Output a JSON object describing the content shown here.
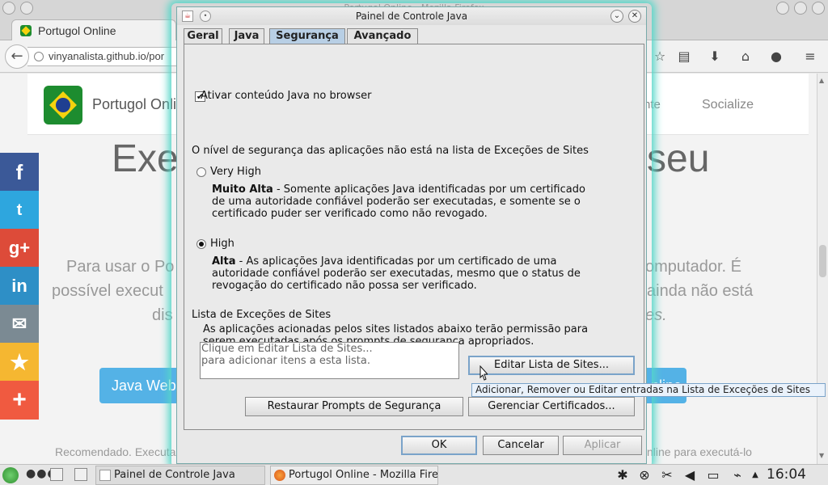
{
  "browser": {
    "window_title": "Portugol Online - Mozilla Firefox",
    "tab_label": "Portugol Online",
    "url": "vinyanalista.github.io/por"
  },
  "page": {
    "site_title": "Portugol Onli",
    "nav_partial": "nte",
    "nav_socialize": "Socialize",
    "hero_left": "Exe",
    "hero_right": "seu",
    "line1_left": "Para usar o Po",
    "line1_right": "omputador. É",
    "line2_left": "possível execut",
    "line2_right": "ainda não está",
    "line3_left": "dis",
    "line3_right": "es.",
    "java_web_button": "Java Web",
    "online_button": "nline",
    "footer_left": "Recomendado. Executa",
    "footer_right": "nline para executá-lo"
  },
  "share": {
    "facebook": "f",
    "twitter": "t",
    "googleplus": "g+",
    "linkedin": "in",
    "email": "✉",
    "favorite": "★",
    "more": "+"
  },
  "dialog": {
    "title": "Painel de Controle Java",
    "tabs": [
      "Geral",
      "Java",
      "Segurança",
      "Avançado"
    ],
    "active_tab": "Segurança",
    "enable_java_label": "Ativar conteúdo Java no browser",
    "enable_java_checked": true,
    "level_notice": "O nível de segurança das aplicações não está na lista de Exceções de Sites",
    "levels": [
      {
        "label": "Very High",
        "selected": false,
        "desc_bold": "Muito Alta",
        "desc_lines": [
          " - Somente aplicações Java identificadas por um certificado",
          "de uma autoridade confiável poderão ser executadas, e somente se o",
          "certificado puder ser verificado como não revogado."
        ]
      },
      {
        "label": "High",
        "selected": true,
        "desc_bold": "Alta",
        "desc_lines": [
          " - As aplicações Java identificadas por um certificado de uma",
          "autoridade confiável poderão ser executadas, mesmo que o status de",
          "revogação do certificado não possa ser verificado."
        ]
      }
    ],
    "exceptions_heading": "Lista de Exceções de Sites",
    "exceptions_desc": [
      "As aplicações acionadas pelos sites listados abaixo terão permissão para",
      "serem executadas após os prompts de segurança apropriados."
    ],
    "exceptions_placeholder": [
      "Clique em Editar Lista de Sites...",
      "para adicionar itens a esta lista."
    ],
    "edit_sites_button": "Editar Lista de Sites...",
    "tooltip": "Adicionar, Remover ou Editar entradas na Lista de Exceções de Sites",
    "restore_prompts_button": "Restaurar Prompts de Segurança",
    "manage_certs_button": "Gerenciar Certificados...",
    "ok_button": "OK",
    "cancel_button": "Cancelar",
    "apply_button": "Aplicar"
  },
  "taskbar": {
    "task1": "Painel de Controle Java",
    "task2": "Portugol Online - Mozilla Firefox",
    "clock": "16:04"
  },
  "colors": {
    "facebook": "#3b5998",
    "twitter": "#2ea6de",
    "googleplus": "#dd4b39",
    "linkedin": "#2e8fc6",
    "email": "#7b8a93",
    "favorite": "#f5b731",
    "more": "#f05a40",
    "dialog_glow": "#55d6c8",
    "accent_button": "#54b2e6"
  }
}
